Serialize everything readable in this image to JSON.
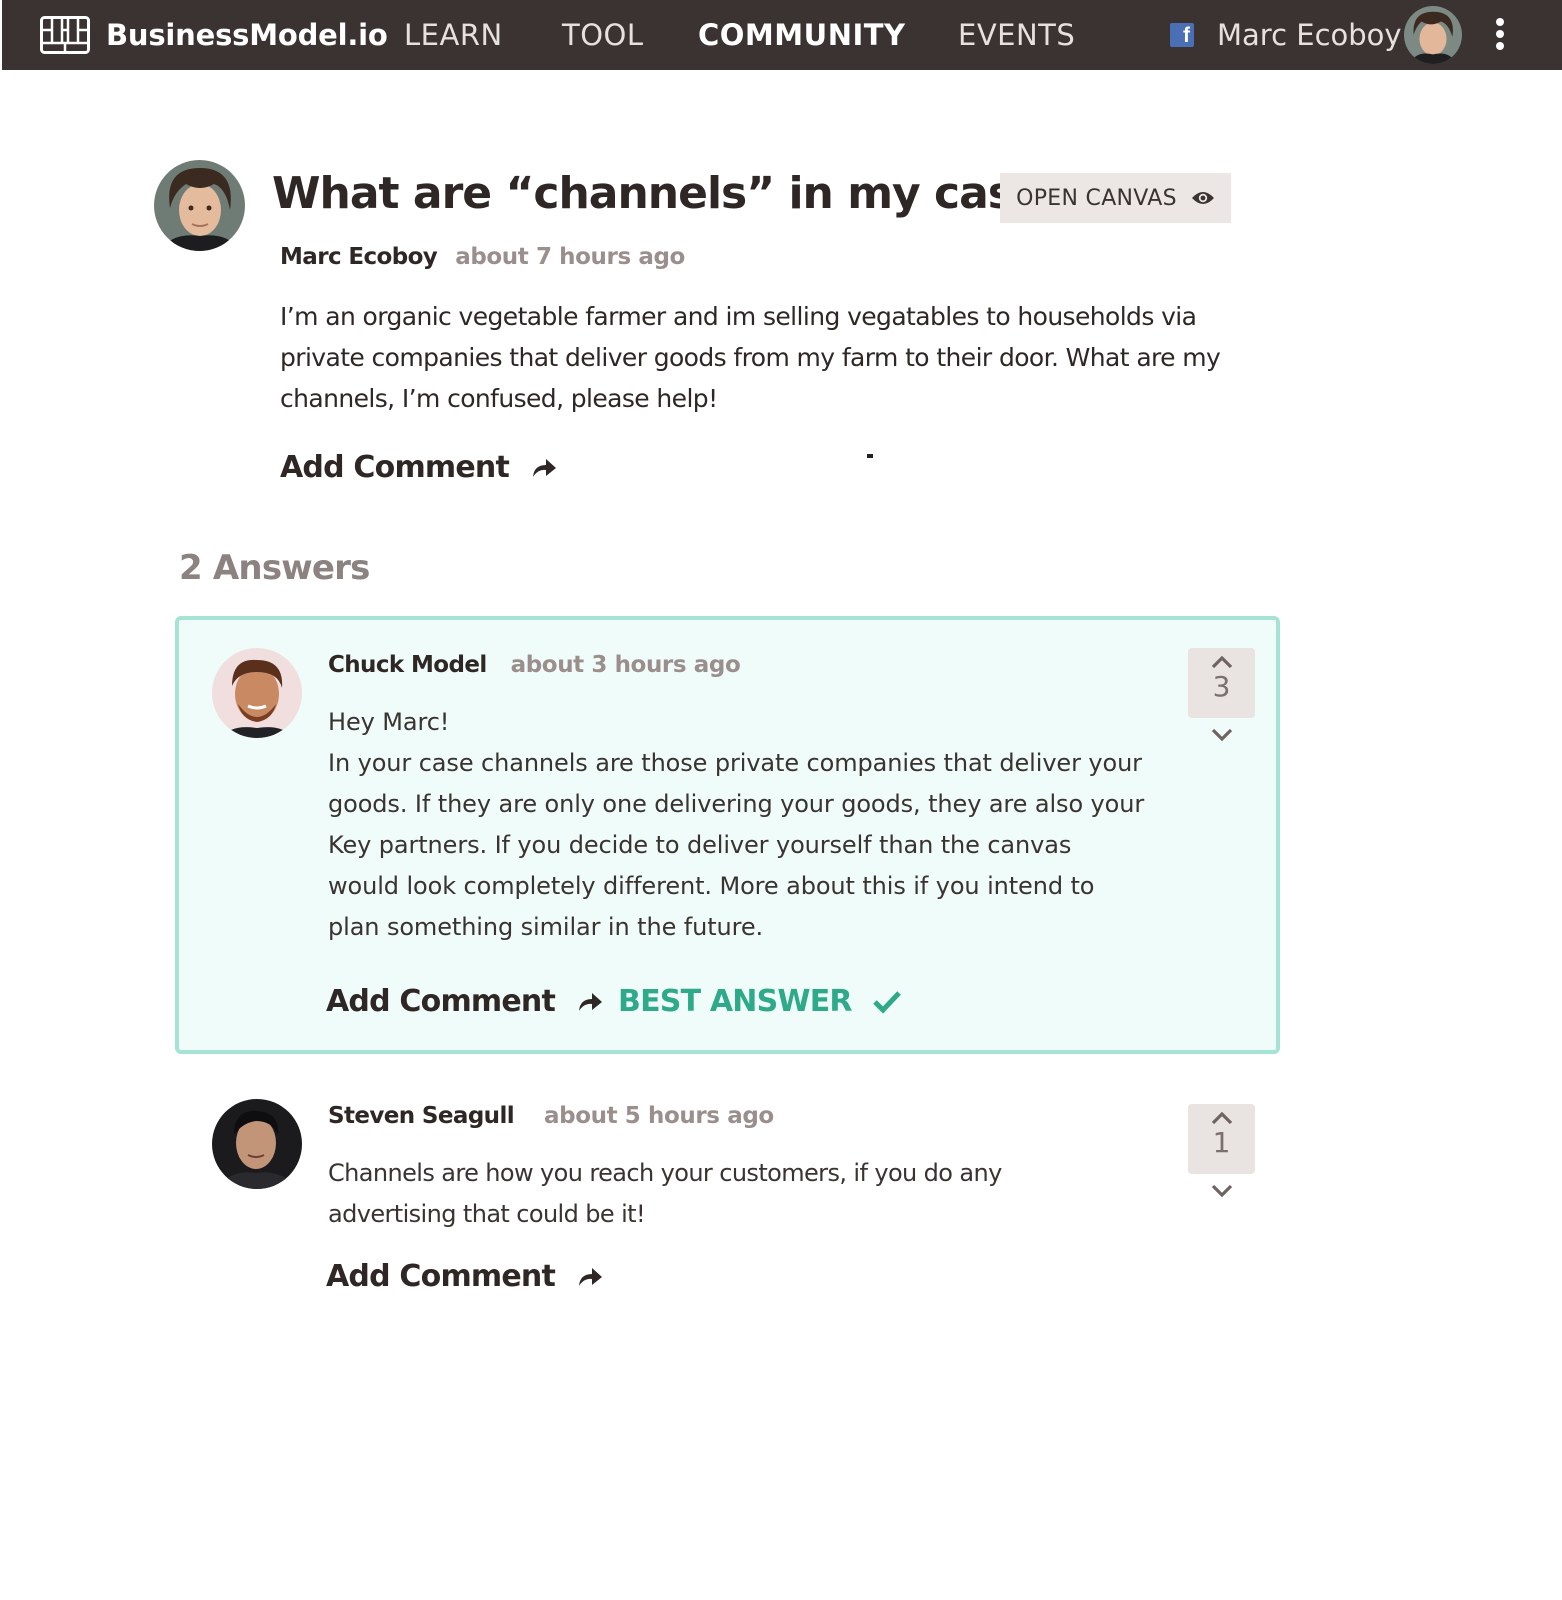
{
  "nav": {
    "brand": "BusinessModel.io",
    "links": [
      "LEARN",
      "TOOL",
      "COMMUNITY",
      "EVENTS"
    ],
    "active": "COMMUNITY",
    "user_name": "Marc Ecoboy",
    "fb_glyph": "f",
    "colors": {
      "bar": "#3a3331",
      "text": "#e6e1df"
    }
  },
  "question": {
    "title": "What are “channels” in my case?",
    "open_canvas_label": "OPEN CANVAS",
    "author": "Marc Ecoboy",
    "time": "about 7 hours ago",
    "body": "I’m an organic vegetable farmer and im selling vegatables to households via private companies that deliver goods from my farm to their door. What are my channels, I’m confused, please help!",
    "add_comment_label": "Add Comment"
  },
  "answers_count_label": "2 Answers",
  "answers": [
    {
      "author": "Chuck Model",
      "time": "about 3 hours ago",
      "greeting": "Hey Marc!",
      "body": "In your case channels are those private companies that deliver your goods. If they are only one delivering your goods, they are also your Key partners. If you decide to deliver yourself than the canvas would look completely different. More about this if you intend to plan something similar in the future.",
      "votes": "3",
      "add_comment_label": "Add Comment",
      "best_answer_label": "BEST ANSWER",
      "is_best": true
    },
    {
      "author": "Steven Seagull",
      "time": "about 5 hours ago",
      "body": "Channels are how you reach your customers, if you do any advertising that could be it!",
      "votes": "1",
      "add_comment_label": "Add Comment",
      "is_best": false
    }
  ],
  "icons": [
    "canvas-grid-logo-icon",
    "facebook-icon",
    "avatar",
    "more-vertical-icon",
    "eye-icon",
    "reply-arrow-icon",
    "chevron-up-icon",
    "chevron-down-icon",
    "checkmark-icon"
  ],
  "colors": {
    "best_border": "#a6e3d4",
    "best_bg": "#effcf9",
    "best_text": "#2eaa8a",
    "muted": "#9a8f8c"
  }
}
